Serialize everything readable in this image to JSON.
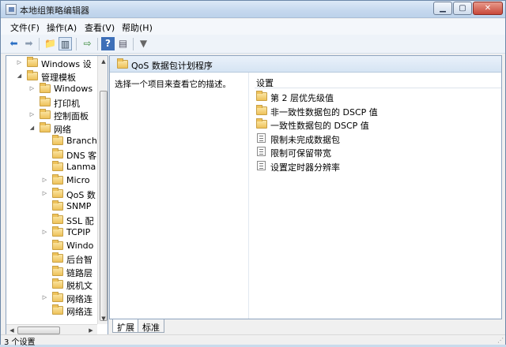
{
  "window": {
    "title": "本地组策略编辑器"
  },
  "window_controls": {
    "minimize": "▁",
    "maximize": "▢",
    "close": "✕"
  },
  "menu": [
    "文件(F)",
    "操作(A)",
    "查看(V)",
    "帮助(H)"
  ],
  "toolbar": {
    "icons": [
      "back-arrow-icon",
      "forward-arrow-icon",
      "up-folder-icon",
      "show-hide-tree-icon",
      "export-list-icon",
      "help-icon",
      "properties-icon",
      "filter-icon"
    ]
  },
  "tree": {
    "items": [
      {
        "label": "Windows 设",
        "expander": "▷"
      },
      {
        "label": "管理模板",
        "expander": "◢"
      },
      {
        "label": "Windows",
        "expander": "▷"
      },
      {
        "label": "打印机",
        "expander": ""
      },
      {
        "label": "控制面板",
        "expander": "▷"
      },
      {
        "label": "网络",
        "expander": "◢"
      },
      {
        "label": "Branch",
        "expander": ""
      },
      {
        "label": "DNS 客",
        "expander": ""
      },
      {
        "label": "Lanma",
        "expander": ""
      },
      {
        "label": "Micro",
        "expander": "▷"
      },
      {
        "label": "QoS 数",
        "expander": "▷"
      },
      {
        "label": "SNMP",
        "expander": ""
      },
      {
        "label": "SSL 配",
        "expander": ""
      },
      {
        "label": "TCPIP",
        "expander": "▷"
      },
      {
        "label": "Windo",
        "expander": ""
      },
      {
        "label": "后台智",
        "expander": ""
      },
      {
        "label": "链路层",
        "expander": ""
      },
      {
        "label": "脱机文",
        "expander": ""
      },
      {
        "label": "网络连",
        "expander": "▷"
      },
      {
        "label": "网络连",
        "expander": ""
      }
    ]
  },
  "right_pane": {
    "header_title": "QoS 数据包计划程序",
    "description": "选择一个项目来查看它的描述。",
    "settings_header": "设置",
    "settings": [
      {
        "label": "第 2 层优先级值",
        "icon": "folder-icon"
      },
      {
        "label": "非一致性数据包的 DSCP 值",
        "icon": "folder-icon"
      },
      {
        "label": "一致性数据包的 DSCP 值",
        "icon": "folder-icon"
      },
      {
        "label": "限制未完成数据包",
        "icon": "policy-setting-icon"
      },
      {
        "label": "限制可保留带宽",
        "icon": "policy-setting-icon"
      },
      {
        "label": "设置定时器分辨率",
        "icon": "policy-setting-icon"
      }
    ]
  },
  "tabs": [
    "扩展",
    "标准"
  ],
  "status": {
    "text": "3 个设置"
  },
  "scroll": {
    "up": "▲",
    "down": "▼",
    "left": "◀",
    "right": "▶"
  }
}
